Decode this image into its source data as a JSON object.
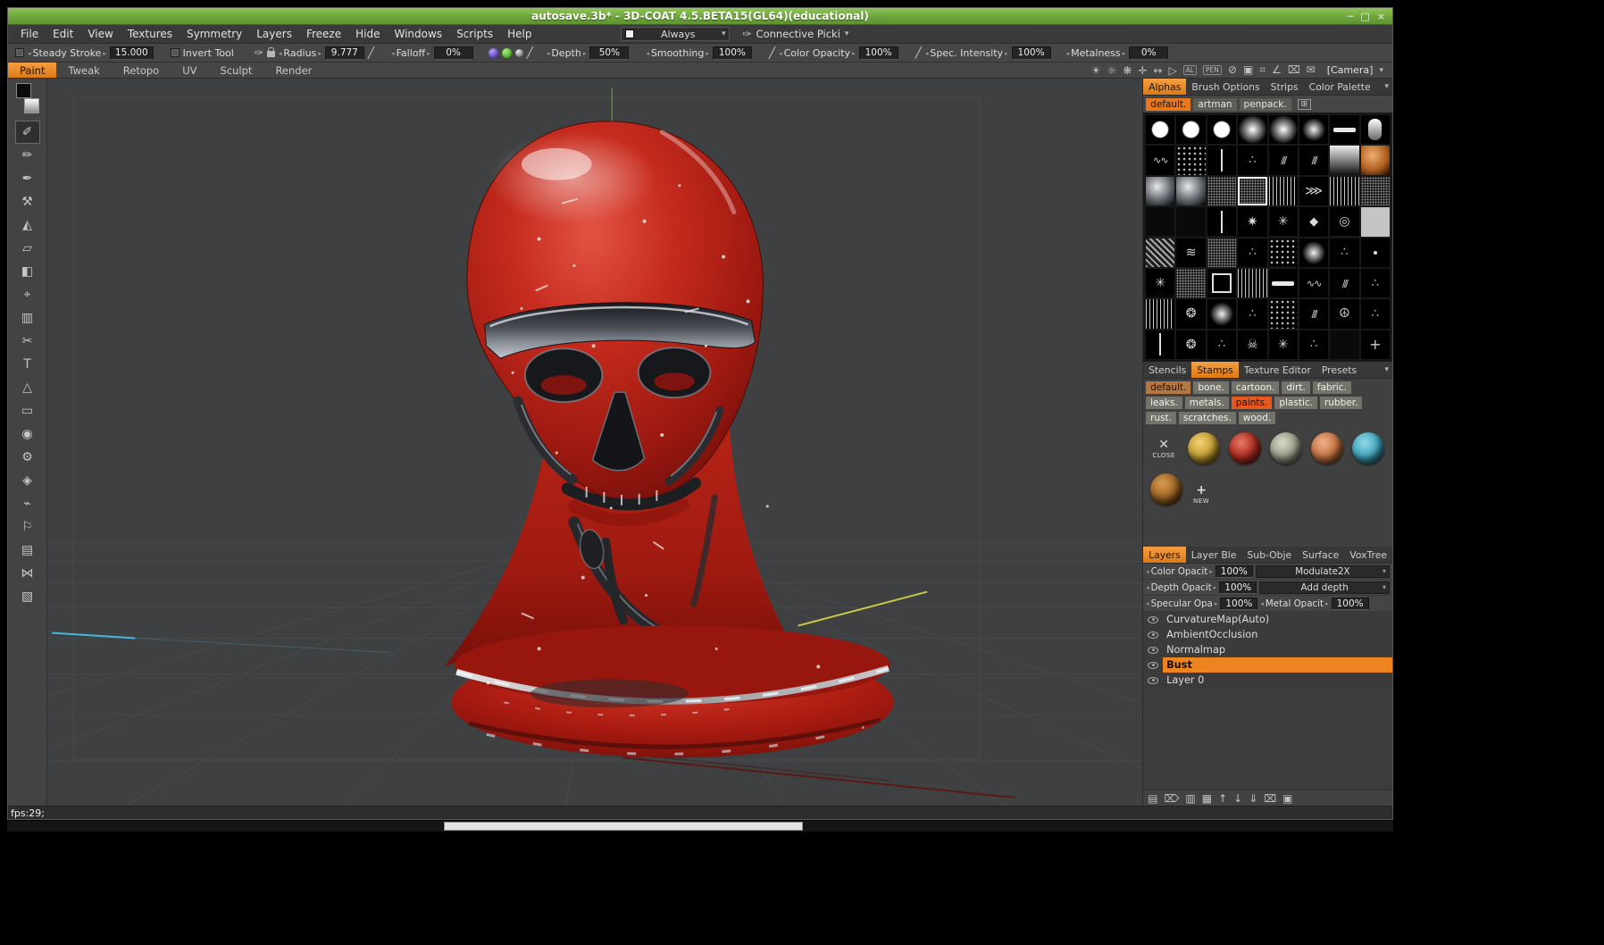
{
  "window": {
    "title": "autosave.3b* - 3D-COAT 4.5.BETA15(GL64)(educational)",
    "controls": [
      {
        "name": "minimize",
        "glyph": "─"
      },
      {
        "name": "maximize",
        "glyph": "□"
      },
      {
        "name": "close",
        "glyph": "×"
      }
    ]
  },
  "menubar": {
    "items": [
      "File",
      "Edit",
      "View",
      "Textures",
      "Symmetry",
      "Layers",
      "Freeze",
      "Hide",
      "Windows",
      "Scripts",
      "Help"
    ],
    "always_label": "Always",
    "picker_label": "Connective Picki"
  },
  "toolbar": {
    "steady_stroke": {
      "label": "Steady Stroke",
      "value": "15.000"
    },
    "invert_tool_label": "Invert Tool",
    "radius": {
      "label": "Radius",
      "value": "9.777"
    },
    "falloff": {
      "label": "Falloff",
      "value": "0%"
    },
    "depth": {
      "label": "Depth",
      "value": "50%"
    },
    "smoothing": {
      "label": "Smoothing",
      "value": "100%"
    },
    "color_opacity": {
      "label": "Color Opacity",
      "value": "100%"
    },
    "spec_intensity": {
      "label": "Spec. Intensity",
      "value": "100%"
    },
    "metalness": {
      "label": "Metalness",
      "value": "0%"
    }
  },
  "rooms": {
    "tabs": [
      {
        "label": "Paint",
        "active": true
      },
      {
        "label": "Tweak"
      },
      {
        "label": "Retopo"
      },
      {
        "label": "UV"
      },
      {
        "label": "Sculpt"
      },
      {
        "label": "Render"
      }
    ],
    "icons": [
      {
        "name": "render-light-icon",
        "glyph": "☀"
      },
      {
        "name": "ambient-light-icon",
        "glyph": "☼"
      },
      {
        "name": "sparkle-icon",
        "glyph": "❋"
      },
      {
        "name": "gizmo-icon",
        "glyph": "✛"
      },
      {
        "name": "pan-icon",
        "glyph": "↔"
      },
      {
        "name": "play-icon",
        "glyph": "▷"
      }
    ],
    "badges": {
      "all": "AL",
      "pen": "PEN"
    },
    "icons2": [
      {
        "name": "no-culling-icon",
        "glyph": "⊘"
      },
      {
        "name": "shield-icon",
        "glyph": "▣"
      },
      {
        "name": "grid-icon",
        "glyph": "⌗"
      },
      {
        "name": "angle-snap-icon",
        "glyph": "∠"
      },
      {
        "name": "clear-mask-icon",
        "glyph": "⌧"
      },
      {
        "name": "letterbox-icon",
        "glyph": "✉"
      }
    ],
    "camera_label": "[Camera]"
  },
  "left_tools": [
    {
      "name": "brush-tool",
      "glyph": "✐",
      "active": true
    },
    {
      "name": "pencil-tool",
      "glyph": "✏"
    },
    {
      "name": "airbrush-tool",
      "glyph": "✒"
    },
    {
      "name": "chisel-tool",
      "glyph": "⚒"
    },
    {
      "name": "smudge-tool",
      "glyph": "◭"
    },
    {
      "name": "flatten-tool",
      "glyph": "▱"
    },
    {
      "name": "fill-tool",
      "glyph": "◧"
    },
    {
      "name": "pick-tool",
      "glyph": "⌖"
    },
    {
      "name": "pages-tool",
      "glyph": "▥"
    },
    {
      "name": "cut-tool",
      "glyph": "✂"
    },
    {
      "name": "text-tool",
      "glyph": "T"
    },
    {
      "name": "shapes-tool",
      "glyph": "△"
    },
    {
      "name": "eraser-tool",
      "glyph": "▭"
    },
    {
      "name": "visibility-tool",
      "glyph": "◉"
    },
    {
      "name": "gear-tool",
      "glyph": "⚙"
    },
    {
      "name": "stencil-tool",
      "glyph": "◈"
    },
    {
      "name": "wand-tool",
      "glyph": "⌁"
    },
    {
      "name": "knife-tool",
      "glyph": "⚐"
    },
    {
      "name": "roller-tool",
      "glyph": "▤"
    },
    {
      "name": "symmetry-tool",
      "glyph": "⋈"
    },
    {
      "name": "measure-tool",
      "glyph": "▧"
    }
  ],
  "alphas_panel": {
    "tabs": [
      {
        "label": "Alphas",
        "active": true
      },
      {
        "label": "Brush Options"
      },
      {
        "label": "Strips"
      },
      {
        "label": "Color Palette"
      }
    ],
    "groups": [
      {
        "label": "default.",
        "active": true
      },
      {
        "label": "artman"
      },
      {
        "label": "penpack."
      }
    ],
    "cells": [
      {
        "kind": "disc-hard"
      },
      {
        "kind": "disc-hard"
      },
      {
        "kind": "disc-hard"
      },
      {
        "kind": "disc-soft"
      },
      {
        "kind": "disc-soft"
      },
      {
        "kind": "disc-faint"
      },
      {
        "kind": "bar-h"
      },
      {
        "kind": "capsule"
      },
      {
        "kind": "squiggle"
      },
      {
        "kind": "dots"
      },
      {
        "kind": "line-v"
      },
      {
        "kind": "scatter"
      },
      {
        "kind": "scratch"
      },
      {
        "kind": "scratch"
      },
      {
        "kind": "grad-v"
      },
      {
        "kind": "sphere-orange"
      },
      {
        "kind": "sphere-duo"
      },
      {
        "kind": "sphere-duo"
      },
      {
        "kind": "noise"
      },
      {
        "kind": "noise",
        "selected": true
      },
      {
        "kind": "streaks"
      },
      {
        "kind": "chevrons"
      },
      {
        "kind": "streaks"
      },
      {
        "kind": "noise"
      },
      {
        "kind": "empty"
      },
      {
        "kind": "empty"
      },
      {
        "kind": "line-v"
      },
      {
        "kind": "burst"
      },
      {
        "kind": "star"
      },
      {
        "kind": "diamond"
      },
      {
        "kind": "dotring"
      },
      {
        "kind": "square-light"
      },
      {
        "kind": "weave"
      },
      {
        "kind": "waves"
      },
      {
        "kind": "noise"
      },
      {
        "kind": "scatter"
      },
      {
        "kind": "dots"
      },
      {
        "kind": "disc-faint"
      },
      {
        "kind": "scatter"
      },
      {
        "kind": "dot-small"
      },
      {
        "kind": "star"
      },
      {
        "kind": "noise"
      },
      {
        "kind": "square-outline"
      },
      {
        "kind": "streaks"
      },
      {
        "kind": "bar-h"
      },
      {
        "kind": "squiggle"
      },
      {
        "kind": "scratch"
      },
      {
        "kind": "scatter"
      },
      {
        "kind": "streaks"
      },
      {
        "kind": "swirl"
      },
      {
        "kind": "disc-faint"
      },
      {
        "kind": "scatter"
      },
      {
        "kind": "dots"
      },
      {
        "kind": "scratch"
      },
      {
        "kind": "peace"
      },
      {
        "kind": "scatter"
      },
      {
        "kind": "line-v"
      },
      {
        "kind": "swirl"
      },
      {
        "kind": "scatter"
      },
      {
        "kind": "skull"
      },
      {
        "kind": "star"
      },
      {
        "kind": "scatter"
      },
      {
        "kind": "empty"
      },
      {
        "kind": "plus"
      }
    ]
  },
  "stamps_panel": {
    "tabs": [
      {
        "label": "Stencils"
      },
      {
        "label": "Stamps",
        "active": true
      },
      {
        "label": "Texture Editor"
      },
      {
        "label": "Presets"
      }
    ],
    "categories": [
      {
        "label": "default.",
        "kind": "warm"
      },
      {
        "label": "bone."
      },
      {
        "label": "cartoon."
      },
      {
        "label": "dirt."
      },
      {
        "label": "fabric."
      },
      {
        "label": "leaks."
      },
      {
        "label": "metals."
      },
      {
        "label": "paints.",
        "active": true
      },
      {
        "label": "plastic."
      },
      {
        "label": "rubber."
      },
      {
        "label": "rust."
      },
      {
        "label": "scratches."
      },
      {
        "label": "wood."
      }
    ],
    "close_label": "CLOSE",
    "new_label": "NEW",
    "materials_row1": [
      {
        "name": "gold-material",
        "kind": "gold",
        "color": "#c9a43a"
      },
      {
        "name": "red-material",
        "kind": "red",
        "color": "#b03024"
      },
      {
        "name": "olive-material",
        "kind": "olive",
        "color": "#9aa08a"
      },
      {
        "name": "copper-material",
        "kind": "copper",
        "color": "#c87848"
      },
      {
        "name": "teal-material",
        "kind": "teal",
        "color": "#48a8c0"
      }
    ],
    "materials_row2": [
      {
        "name": "bronze-material",
        "kind": "bronze",
        "color": "#a06828"
      }
    ]
  },
  "layers_panel": {
    "tabs": [
      {
        "label": "Layers",
        "active": true
      },
      {
        "label": "Layer Ble"
      },
      {
        "label": "Sub-Obje"
      },
      {
        "label": "Surface"
      },
      {
        "label": "VoxTree"
      }
    ],
    "color_opacity": {
      "label": "Color Opacit",
      "value": "100%"
    },
    "blend_mode": "Modulate2X",
    "depth_opacity": {
      "label": "Depth Opacit",
      "value": "100%"
    },
    "depth_mode": "Add depth",
    "specular_opacity": {
      "label": "Specular Opa",
      "value": "100%"
    },
    "metal_opacity": {
      "label": "Metal Opacit",
      "value": "100%"
    },
    "layers": [
      {
        "name": "CurvatureMap(Auto)"
      },
      {
        "name": "AmbientOcclusion"
      },
      {
        "name": "Normalmap"
      },
      {
        "name": "Bust",
        "selected": true
      },
      {
        "name": "Layer 0"
      }
    ],
    "ops": [
      {
        "name": "new-layer-icon",
        "glyph": "▤"
      },
      {
        "name": "delete-layer-icon",
        "glyph": "⌦"
      },
      {
        "name": "duplicate-layer-icon",
        "glyph": "▥"
      },
      {
        "name": "copy-layer-icon",
        "glyph": "▦"
      },
      {
        "name": "move-up-icon",
        "glyph": "↑"
      },
      {
        "name": "move-down-icon",
        "glyph": "↓"
      },
      {
        "name": "merge-down-icon",
        "glyph": "⇓"
      },
      {
        "name": "clear-layer-icon",
        "glyph": "⌧"
      },
      {
        "name": "folder-icon",
        "glyph": "▣"
      }
    ]
  },
  "statusbar": {
    "fps": "fps:29;"
  },
  "colors": {
    "accent_orange": "#ee8420",
    "title_green": "#6ba33a",
    "viewport_bg": "#3e4042",
    "bust_red": "#c62b1d",
    "bust_metal": "#8a9097"
  }
}
